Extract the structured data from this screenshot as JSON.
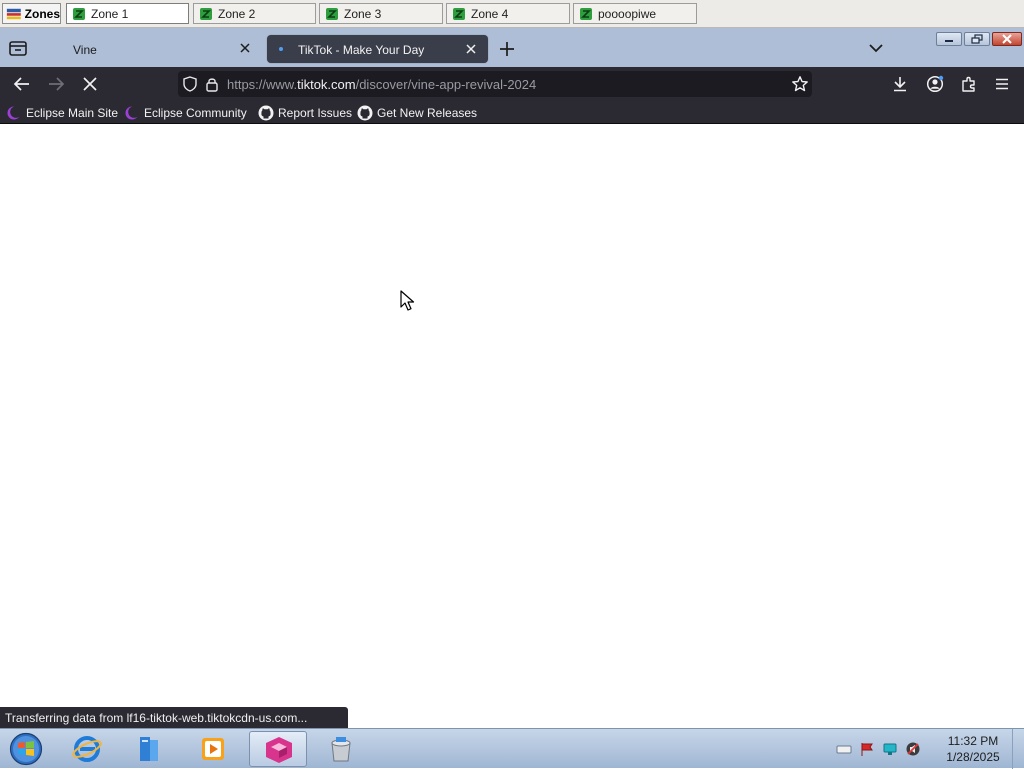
{
  "zones_bar": {
    "button_label": "Zones",
    "tabs": [
      {
        "label": "Zone 1",
        "active": true
      },
      {
        "label": "Zone 2",
        "active": false
      },
      {
        "label": "Zone 3",
        "active": false
      },
      {
        "label": "Zone 4",
        "active": false
      },
      {
        "label": "poooopiwe",
        "active": false
      }
    ]
  },
  "browser": {
    "tabs": [
      {
        "title": "Vine",
        "active": false
      },
      {
        "title": "TikTok - Make Your Day",
        "active": true,
        "loading": true
      }
    ],
    "url": {
      "prefix": "https://www.",
      "domain": "tiktok.com",
      "path": "/discover/vine-app-revival-2024"
    },
    "bookmarks": [
      {
        "label": "Eclipse Main Site",
        "icon": "eclipse-icon"
      },
      {
        "label": "Eclipse Community",
        "icon": "eclipse-icon"
      },
      {
        "label": "Report Issues",
        "icon": "github-icon"
      },
      {
        "label": "Get New Releases",
        "icon": "github-icon"
      }
    ],
    "status_text": "Transferring data from lf16-tiktok-web.tiktokcdn-us.com...",
    "accent": "#4f9df5"
  },
  "taskbar": {
    "pinned": [
      "internet-explorer-icon",
      "file-manager-icon",
      "media-player-icon",
      "browser-icon",
      "installer-icon"
    ],
    "clock_time": "11:32 PM",
    "clock_date": "1/28/2025"
  }
}
